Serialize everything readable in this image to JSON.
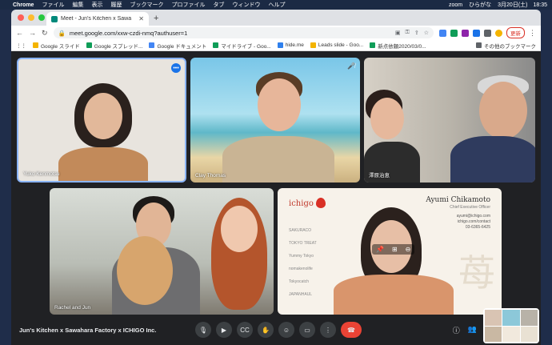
{
  "menubar": {
    "app": "Chrome",
    "items": [
      "ファイル",
      "編集",
      "表示",
      "履歴",
      "ブックマーク",
      "プロファイル",
      "タブ",
      "ウィンドウ",
      "ヘルプ"
    ],
    "status_app": "zoom",
    "ime": "ひらがな",
    "clock": "3月20日(土)　18:35"
  },
  "browser": {
    "tab_title": "Meet - Jun's Kitchen x Sawa",
    "url": "meet.google.com/xxw-czdi-nmq?authuser=1",
    "update_label": "更新",
    "bookmarks": [
      {
        "label": "Google スライド",
        "color": "#f4b400"
      },
      {
        "label": "Google スプレッド...",
        "color": "#0f9d58"
      },
      {
        "label": "Google ドキュメント",
        "color": "#4285f4"
      },
      {
        "label": "マイドライブ - Goo...",
        "color": "#0f9d58"
      },
      {
        "label": "hide.me",
        "color": "#2f80ed"
      },
      {
        "label": "Leads slide - Goo...",
        "color": "#f4b400"
      },
      {
        "label": "新点依頼2020/03/0...",
        "color": "#0f9d58"
      }
    ],
    "other_bookmarks": "その他のブックマーク"
  },
  "meet": {
    "participants": [
      {
        "name": "Yuko Kenmotsu"
      },
      {
        "name": "Clay Thomas"
      },
      {
        "name": "澤原治恵"
      },
      {
        "name": "Rachel and Jun"
      },
      {
        "name": "Ayumi Chikamoto"
      }
    ],
    "card": {
      "logo": "ichigo",
      "name": "Ayumi Chikamoto",
      "role": "Chief Executive Officer",
      "email": "ayumi@ichigo.com",
      "web": "ichigo.com/contact",
      "phone": "03-6365-6425",
      "brands": [
        "SAKURACO",
        "TOKYO TREAT",
        "Yummy Tokyo",
        "nomakenolife",
        "Tokyocatch",
        "JAPANHAUL"
      ],
      "brush_char": "苺"
    },
    "meeting_title": "Jun's Kitchen x Sawahara Factory x ICHIGO Inc.",
    "controls": [
      "mic-icon",
      "camera-icon",
      "captions-icon",
      "raise-hand-icon",
      "emoji-icon",
      "present-icon",
      "more-icon",
      "hangup-icon"
    ],
    "control_glyphs": [
      "🎙",
      "▶",
      "CC",
      "✋",
      "☺",
      "▭",
      "⋮",
      "☎"
    ]
  }
}
